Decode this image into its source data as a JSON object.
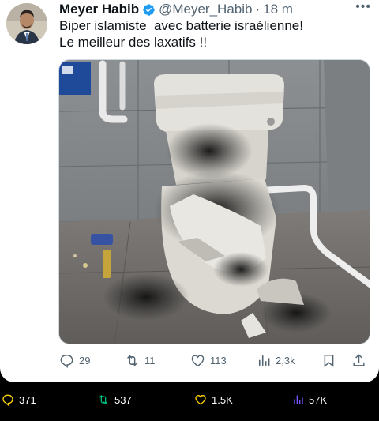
{
  "tweet": {
    "display_name": "Meyer Habib",
    "handle": "@Meyer_Habib",
    "separator": "·",
    "time": "18 m",
    "more_icon": "more-horizontal-icon",
    "text_lines": [
      "Biper islamiste  avec batterie israélienne!",
      "Le meilleur des laxatifs !!"
    ],
    "media_alt": "burnt toilet photo",
    "actions": {
      "replies": "29",
      "retweets": "11",
      "likes": "113",
      "views": "2,3k"
    }
  },
  "bottom_bar": {
    "replies": "371",
    "retweets": "537",
    "likes": "1.5K",
    "views": "57K"
  },
  "colors": {
    "text": "#0f1419",
    "secondary": "#536471",
    "verified": "#1d9bf0",
    "retweet_green": "#00ba7c",
    "like_yellow": "#ffd400",
    "views_purple": "#7856ff"
  }
}
